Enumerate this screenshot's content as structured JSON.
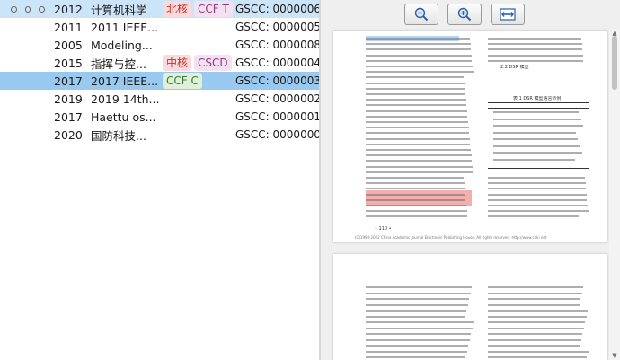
{
  "list": {
    "rows": [
      {
        "year": "2012",
        "title": "计算机科学",
        "tags": [
          {
            "text": "北核",
            "color": "red"
          },
          {
            "text": "CCF T",
            "color": "purple"
          }
        ],
        "code": "GSCC: 0000006",
        "state": "selected-top"
      },
      {
        "year": "2011",
        "title": "2011 IEEE...",
        "tags": [],
        "code": "GSCC: 0000005",
        "state": ""
      },
      {
        "year": "2005",
        "title": "Modeling...",
        "tags": [],
        "code": "GSCC: 0000008",
        "state": ""
      },
      {
        "year": "2015",
        "title": "指挥与控...",
        "tags": [
          {
            "text": "中核",
            "color": "red"
          },
          {
            "text": "CSCD",
            "color": "purple"
          }
        ],
        "code": "GSCC: 0000004",
        "state": ""
      },
      {
        "year": "2017",
        "title": "2017 IEEE...",
        "tags": [
          {
            "text": "CCF C",
            "color": "green"
          }
        ],
        "code": "GSCC: 0000003",
        "state": "selected"
      },
      {
        "year": "2019",
        "title": "2019 14th...",
        "tags": [],
        "code": "GSCC: 0000002",
        "state": ""
      },
      {
        "year": "2017",
        "title": "Haettu os...",
        "tags": [],
        "code": "GSCC: 0000001",
        "state": ""
      },
      {
        "year": "2020",
        "title": "国防科技...",
        "tags": [],
        "code": "GSCC: 0000000",
        "state": ""
      }
    ]
  },
  "viewer": {
    "toolbar": {
      "zoom_out_icon": "zoom-out-icon",
      "zoom_in_icon": "zoom-in-icon",
      "fit_width_icon": "fit-width-icon"
    },
    "page1": {
      "page_number": "• 110 •",
      "footer": "(C)1994-2022 China Academic Journal Electronic Publishing House. All rights reserved.   http://www.cnki.net",
      "section_title": "2.2 DSR 模型",
      "table_caption": "表 1  DSR 模型语言示例"
    }
  },
  "colors": {
    "selected_top": "#cce4f7",
    "selected": "#99c9ef",
    "highlight_blue": "#9ec5ef",
    "highlight_red": "#f39a9a"
  }
}
